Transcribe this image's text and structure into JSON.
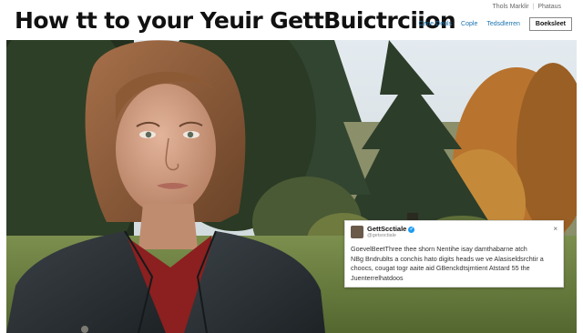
{
  "header": {
    "headline": "How tt to your Yeuir GettBuictrciion",
    "utility_links": [
      "Thols Marklir",
      "Phataus"
    ],
    "nav_links": [
      "Cene Deols",
      "Cople",
      "Tedsdlerren"
    ],
    "cta_label": "Boeksleet"
  },
  "embed": {
    "name": "GettScctiale",
    "handle": "@getsoctiale",
    "close_icon": "×",
    "lines": [
      "GoevelBeetThree thee shorn Nentihe isay damthabarne atch",
      "NBg Bndrublts a conchis hato digits heads we ve Alasiseldsrchtir a",
      "choocs, cougat togr aaite aid GBenckdtsjmtient Atstard 55 the",
      "Juenterrelhatdoos"
    ]
  }
}
